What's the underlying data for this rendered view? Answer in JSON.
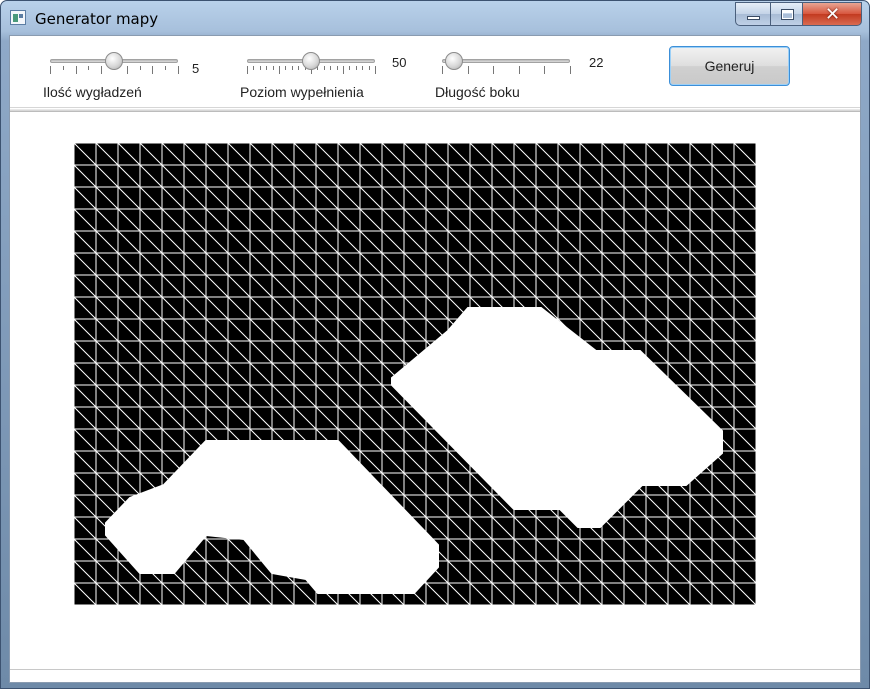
{
  "window": {
    "title": "Generator mapy",
    "icon": "app-icon",
    "controls": {
      "minimize": "minimize-icon",
      "maximize": "maximize-icon",
      "close": "close-icon",
      "close_glyph": "✕"
    }
  },
  "toolbar": {
    "sliders": [
      {
        "label": "Ilość wygładzeń",
        "value": "5",
        "level": 0.5
      },
      {
        "label": "Poziom wypełnienia",
        "value": "50",
        "level": 0.5
      },
      {
        "label": "Długość boku",
        "value": "22",
        "level": 0.09
      }
    ],
    "generate_label": "Generuj"
  },
  "map": {
    "grid_columns": 31,
    "grid_rows": 21,
    "wall_color": "#000000",
    "floor_color": "#ffffff",
    "line_color": "#ffffff"
  }
}
